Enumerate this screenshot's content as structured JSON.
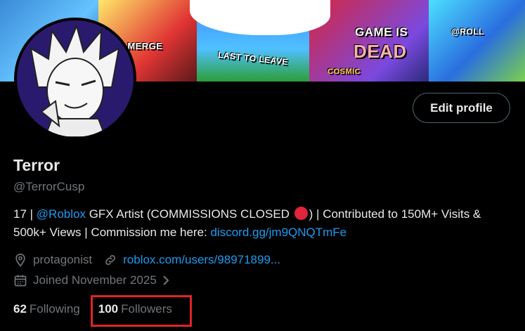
{
  "banner": {
    "texts": {
      "merge": "E MERGE",
      "last": "LAST TO LEAVE",
      "game": "GAME IS",
      "dead": "DEAD",
      "roll": "@ROLL",
      "cos": "COSMIC"
    }
  },
  "profile": {
    "edit_label": "Edit profile",
    "name": "Terror",
    "handle": "@TerrorCusp",
    "bio": {
      "p1": "17 | ",
      "mention": "@Roblox",
      "p2": " GFX Artist (COMMISSIONS CLOSED ",
      "p3": ") | Contributed to 150M+ Visits & 500k+ Views | Commission me here: ",
      "link": "discord.gg/jm9QNQTmFe"
    },
    "location": "protagonist",
    "website": "roblox.com/users/98971899...",
    "joined": "Joined November 2025",
    "following_count": "62",
    "following_label": "Following",
    "followers_count": "100",
    "followers_label": "Followers"
  },
  "icons": {
    "location": "location-pin-icon",
    "website": "link-icon",
    "joined": "calendar-icon",
    "joined_more": "chevron-right-icon"
  },
  "colors": {
    "accent": "#1d9bf0",
    "highlight_box": "#e02424",
    "muted_text": "#71767b"
  }
}
